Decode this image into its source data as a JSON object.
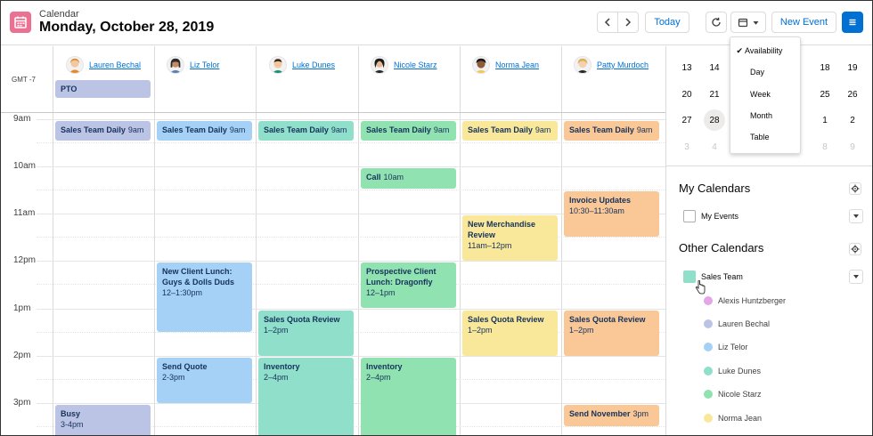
{
  "header": {
    "app_label": "Calendar",
    "date_title": "Monday, October 28, 2019",
    "today_label": "Today",
    "new_event_label": "New Event"
  },
  "timezone": "GMT -7",
  "people": [
    {
      "name": "Lauren Bechal"
    },
    {
      "name": "Liz Telor"
    },
    {
      "name": "Luke Dunes"
    },
    {
      "name": "Nicole Starz"
    },
    {
      "name": "Norma Jean"
    },
    {
      "name": "Patty Murdoch"
    }
  ],
  "hours": [
    "9am",
    "10am",
    "11am",
    "12pm",
    "1pm",
    "2pm",
    "3pm"
  ],
  "events": {
    "pto": {
      "title": "PTO"
    },
    "lauren_daily": {
      "title": "Sales Team Daily",
      "time": "9am"
    },
    "lauren_busy": {
      "title": "Busy",
      "time": "3-4pm"
    },
    "liz_daily": {
      "title": "Sales Team Daily",
      "time": "9am"
    },
    "liz_lunch": {
      "title": "New Client Lunch: Guys & Dolls Duds",
      "time": "12–1:30pm"
    },
    "liz_quote": {
      "title": "Send Quote",
      "time": "2-3pm"
    },
    "luke_daily": {
      "title": "Sales Team Daily",
      "time": "9am"
    },
    "luke_quota": {
      "title": "Sales Quota Review",
      "time": "1–2pm"
    },
    "luke_inventory": {
      "title": "Inventory",
      "time": "2–4pm"
    },
    "nicole_daily": {
      "title": "Sales Team Daily",
      "time": "9am"
    },
    "nicole_call": {
      "title": "Call",
      "time": "10am"
    },
    "nicole_lunch": {
      "title": "Prospective Client Lunch: Dragonfly",
      "time": "12–1pm"
    },
    "nicole_inventory": {
      "title": "Inventory",
      "time": "2–4pm"
    },
    "norma_daily": {
      "title": "Sales Team Daily",
      "time": "9am"
    },
    "norma_merch": {
      "title": "New Merchandise Review",
      "time": "11am–12pm"
    },
    "norma_quota": {
      "title": "Sales Quota Review",
      "time": "1–2pm"
    },
    "patty_daily": {
      "title": "Sales Team Daily",
      "time": "9am"
    },
    "patty_invoice": {
      "title": "Invoice Updates",
      "time": "10:30–11:30am"
    },
    "patty_quota": {
      "title": "Sales Quota Review",
      "time": "1–2pm"
    },
    "patty_november": {
      "title": "Send November",
      "time": "3pm"
    }
  },
  "mini_calendar": {
    "rows": [
      [
        "13",
        "14",
        "",
        "",
        "",
        "18",
        "19"
      ],
      [
        "20",
        "21",
        "",
        "",
        "",
        "25",
        "26"
      ],
      [
        "27",
        "28",
        "",
        "",
        "",
        "1",
        "2"
      ],
      [
        "3",
        "4",
        "",
        "",
        "",
        "8",
        "9"
      ]
    ],
    "today": "28"
  },
  "view_menu": {
    "items": [
      "Availability",
      "Day",
      "Week",
      "Month",
      "Table"
    ],
    "selected": "Availability",
    "check": "✔"
  },
  "my_calendars": {
    "title": "My Calendars",
    "items": [
      {
        "label": "My Events"
      }
    ]
  },
  "other_calendars": {
    "title": "Other Calendars",
    "group_label": "Sales Team",
    "members": [
      {
        "name": "Alexis Huntzberger",
        "color": "#e3a6e6"
      },
      {
        "name": "Lauren Bechal",
        "color": "#bcc4e6"
      },
      {
        "name": "Liz Telor",
        "color": "#a4d1f5"
      },
      {
        "name": "Luke Dunes",
        "color": "#8fdfca"
      },
      {
        "name": "Nicole Starz",
        "color": "#90e3b0"
      },
      {
        "name": "Norma Jean",
        "color": "#f9e79a"
      }
    ]
  },
  "colors": {
    "accent": "#0070d2",
    "brand_icon": "#eb7092",
    "new_event_blue": "#0070d2"
  }
}
